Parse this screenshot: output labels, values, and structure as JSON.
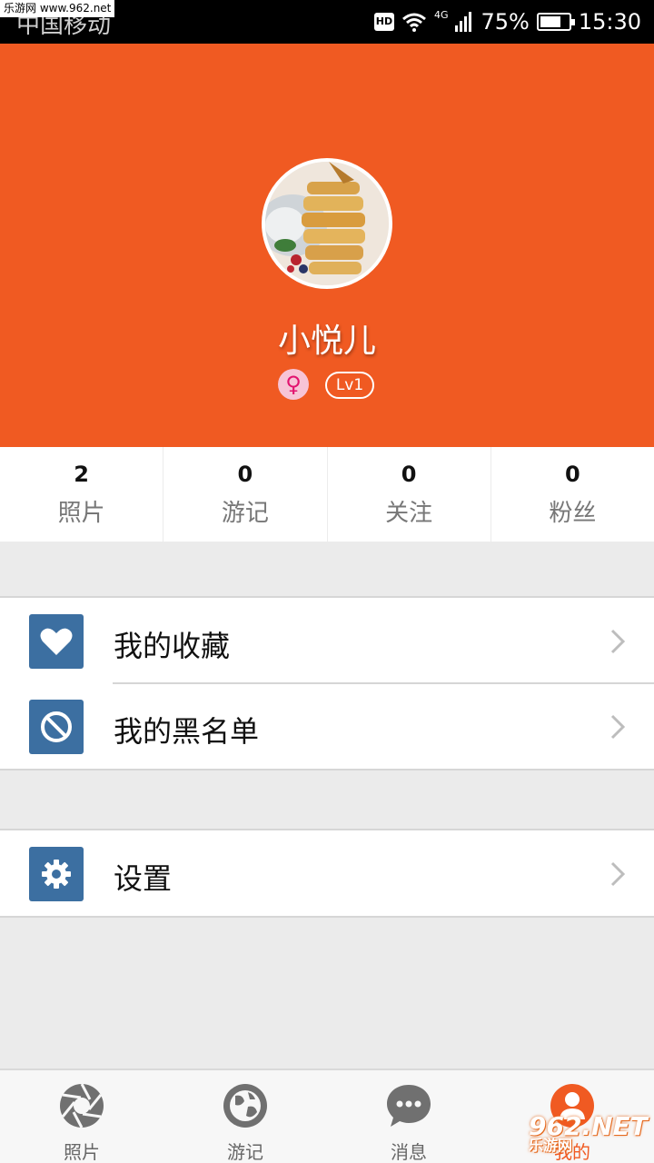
{
  "status_bar": {
    "watermark": "乐游网 www.962.net",
    "carrier": "中国移动",
    "hd_label": "HD",
    "network_label": "4G",
    "battery_percent": "75%",
    "battery_level": 0.75,
    "time": "15:30"
  },
  "profile": {
    "username": "小悦儿",
    "gender_symbol": "♀",
    "level": "Lv1"
  },
  "stats": [
    {
      "count": "2",
      "label": "照片"
    },
    {
      "count": "0",
      "label": "游记"
    },
    {
      "count": "0",
      "label": "关注"
    },
    {
      "count": "0",
      "label": "粉丝"
    }
  ],
  "menu": {
    "favorites_label": "我的收藏",
    "blacklist_label": "我的黑名单",
    "settings_label": "设置"
  },
  "tabs": [
    {
      "label": "照片",
      "icon": "camera-aperture-icon"
    },
    {
      "label": "游记",
      "icon": "globe-icon"
    },
    {
      "label": "消息",
      "icon": "chat-bubble-icon"
    },
    {
      "label": "我的",
      "icon": "user-icon"
    }
  ],
  "watermark_corner": {
    "logo_text": "962.NET",
    "site_name": "乐游网"
  },
  "colors": {
    "accent": "#f05a22",
    "icon_tile": "#3c6fa1",
    "background": "#ebebeb"
  }
}
